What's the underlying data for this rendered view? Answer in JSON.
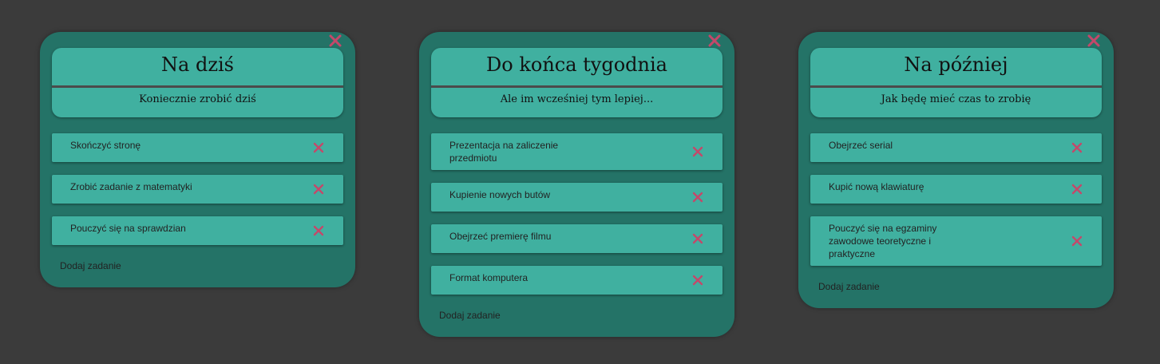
{
  "colors": {
    "background": "#3b3b3b",
    "board": "#247367",
    "card": "#40b0a0",
    "delete_icon": "#c4486a"
  },
  "icons": {
    "board_close": "close-icon",
    "task_delete": "close-icon"
  },
  "boards": [
    {
      "title": "Na dziś",
      "subtitle": "Koniecznie zrobić dziś",
      "tasks": [
        "Skończyć stronę",
        "Zrobić zadanie z matematyki",
        "Pouczyć się na sprawdzian"
      ],
      "add_label": "Dodaj zadanie"
    },
    {
      "title": "Do końca tygodnia",
      "subtitle": "Ale im wcześniej tym lepiej...",
      "tasks": [
        "Prezentacja na zaliczenie przedmiotu",
        "Kupienie nowych butów",
        "Obejrzeć premierę filmu",
        "Format komputera"
      ],
      "add_label": "Dodaj zadanie"
    },
    {
      "title": "Na później",
      "subtitle": "Jak będę mieć czas to zrobię",
      "tasks": [
        "Obejrzeć serial",
        "Kupić nową klawiaturę",
        "Pouczyć się na egzaminy zawodowe teoretyczne i praktyczne"
      ],
      "add_label": "Dodaj zadanie"
    }
  ]
}
